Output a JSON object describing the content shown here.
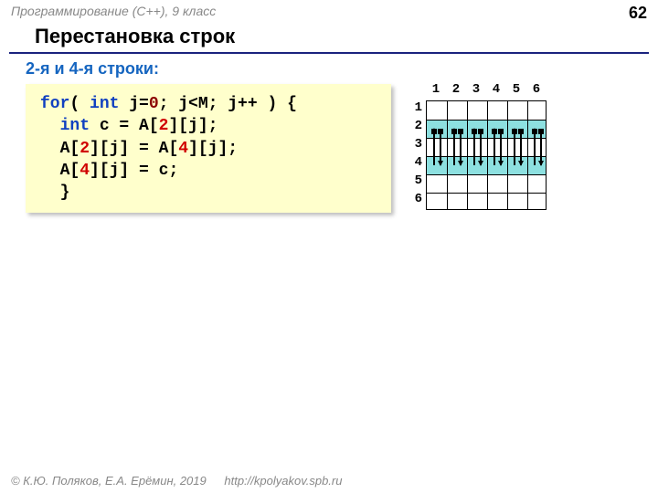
{
  "header": {
    "course": "Программирование (C++), 9 класс",
    "page_number": "62"
  },
  "title": "Перестановка строк",
  "subtitle": "2-я и 4-я строки:",
  "code": {
    "l1_for": "for",
    "l1_open": "( ",
    "l1_int": "int",
    "l1_j": " j=",
    "l1_zero": "0",
    "l1_rest": "; j<M; j++ ) {",
    "l2_indent": "  ",
    "l2_int": "int",
    "l2_a": " c = A[",
    "l2_two": "2",
    "l2_b": "][j];",
    "l3_indent": "  ",
    "l3_a": "A[",
    "l3_two": "2",
    "l3_b": "][j] = A[",
    "l3_four": "4",
    "l3_c": "][j];",
    "l4_indent": "  ",
    "l4_a": "A[",
    "l4_four": "4",
    "l4_b": "][j] = c; ",
    "l5_indent": "  ",
    "l5_brace": "}"
  },
  "grid": {
    "cols": [
      "1",
      "2",
      "3",
      "4",
      "5",
      "6"
    ],
    "rows": [
      "1",
      "2",
      "3",
      "4",
      "5",
      "6"
    ]
  },
  "footer": {
    "copyright": "© К.Ю. Поляков, Е.А. Ерёмин, 2019",
    "url": "http://kpolyakov.spb.ru"
  }
}
